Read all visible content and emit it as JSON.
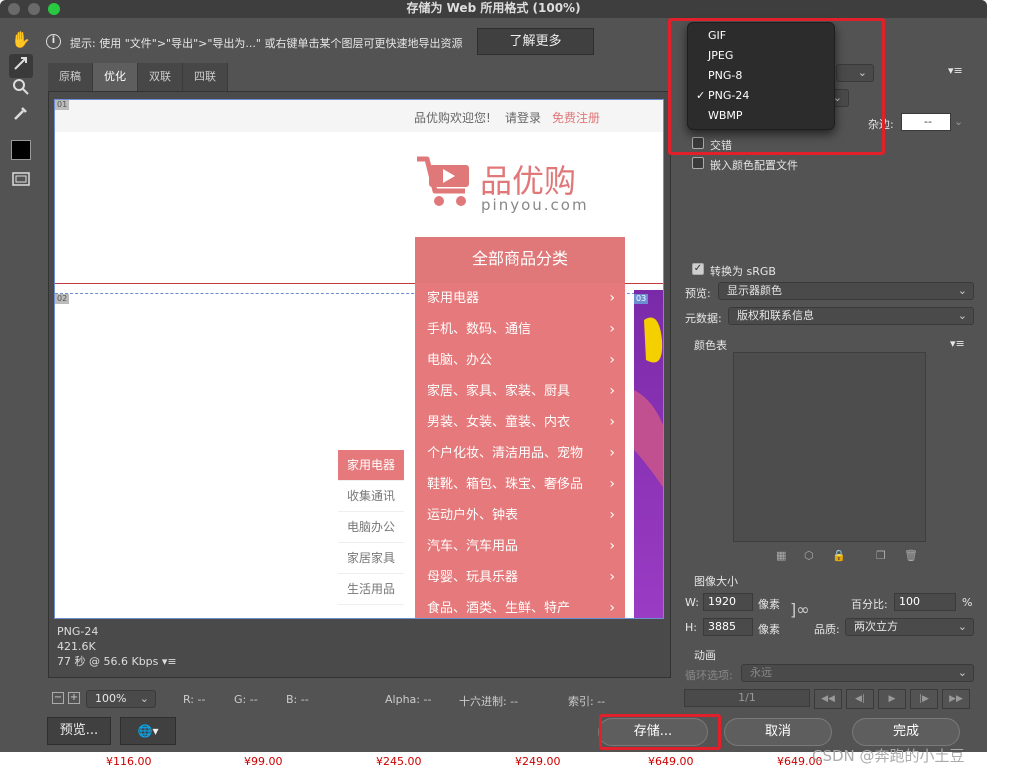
{
  "window": {
    "title": "存储为 Web 所用格式 (100%)"
  },
  "hint": {
    "text": "提示: 使用 \"文件\">\"导出\">\"导出为...\" 或右键单击某个图层可更快速地导出资源",
    "learn_more": "了解更多"
  },
  "tabs": [
    {
      "label": "原稿"
    },
    {
      "label": "优化"
    },
    {
      "label": "双联"
    },
    {
      "label": "四联"
    }
  ],
  "canvas": {
    "slice_labels": [
      "01",
      "02",
      "03"
    ],
    "top_welcome": "品优购欢迎您!",
    "top_login": "请登录",
    "top_register": "免费注册",
    "logo_cn": "品优购",
    "logo_en": "pinyou.com",
    "category_header": "全部商品分类",
    "categories": [
      {
        "label": "家用电器"
      },
      {
        "label": "手机、数码、通信"
      },
      {
        "label": "电脑、办公"
      },
      {
        "label": "家居、家具、家装、厨具"
      },
      {
        "label": "男装、女装、童装、内衣"
      },
      {
        "label": "个户化妆、清洁用品、宠物"
      },
      {
        "label": "鞋靴、箱包、珠宝、奢侈品"
      },
      {
        "label": "运动户外、钟表"
      },
      {
        "label": "汽车、汽车用品"
      },
      {
        "label": "母婴、玩具乐器"
      },
      {
        "label": "食品、酒类、生鲜、特产"
      }
    ],
    "subnav": [
      {
        "label": "家用电器"
      },
      {
        "label": "收集通讯"
      },
      {
        "label": "电脑办公"
      },
      {
        "label": "家居家具"
      },
      {
        "label": "生活用品"
      }
    ],
    "info_format": "PNG-24",
    "info_size": "421.6K",
    "info_time": "77 秒 @ 56.6 Kbps"
  },
  "statusbar": {
    "zoom": "100%",
    "r": "R: --",
    "g": "G: --",
    "b": "B: --",
    "alpha": "Alpha: --",
    "hex": "十六进制: --",
    "index": "索引: --"
  },
  "buttons": {
    "preview": "预览...",
    "save": "存储...",
    "cancel": "取消",
    "done": "完成"
  },
  "format_dropdown": {
    "options": [
      {
        "label": "GIF"
      },
      {
        "label": "JPEG"
      },
      {
        "label": "PNG-8"
      },
      {
        "label": "PNG-24",
        "checked": "✓"
      },
      {
        "label": "WBMP"
      }
    ]
  },
  "panel": {
    "matte_label": "杂边:",
    "matte_value": "--",
    "interlaced": "交错",
    "embed_profile": "嵌入颜色配置文件",
    "convert_srgb": "转换为 sRGB",
    "preview_label": "预览:",
    "preview_value": "显示器颜色",
    "metadata_label": "元数据:",
    "metadata_value": "版权和联系信息",
    "color_table": "颜色表",
    "image_size": "图像大小",
    "w_label": "W:",
    "w_value": "1920",
    "h_label": "H:",
    "h_value": "3885",
    "px_unit": "像素",
    "percent_label": "百分比:",
    "percent_value": "100",
    "percent_unit": "%",
    "quality_label": "品质:",
    "quality_value": "两次立方",
    "animation": "动画",
    "loop_label": "循环选项:",
    "loop_value": "永远",
    "frame_counter": "1/1"
  },
  "background": {
    "prices": [
      "¥116.00",
      "¥99.00",
      "¥245.00",
      "¥249.00",
      "¥649.00",
      "¥649.00"
    ],
    "watermark": "CSDN @奔跑的小土豆"
  },
  "colors": {
    "accent_red": "#e0202a",
    "category_bg": "#e5797b",
    "window_bg": "#535353"
  }
}
